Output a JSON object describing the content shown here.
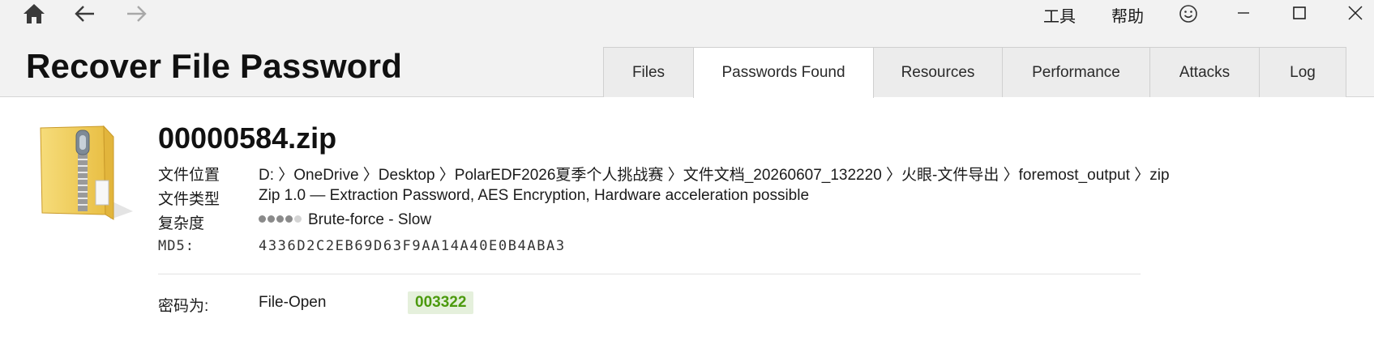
{
  "toolbar": {
    "icons": [
      "home-icon",
      "back-arrow-icon",
      "forward-arrow-icon"
    ]
  },
  "menu": {
    "tools": "工具",
    "help": "帮助",
    "feedback_icon": "smiley-icon"
  },
  "window_controls": [
    "minimize-icon",
    "maximize-icon",
    "close-icon"
  ],
  "app": {
    "title": "Recover File Password"
  },
  "tabs": [
    {
      "label": "Files",
      "active": false
    },
    {
      "label": "Passwords Found",
      "active": true
    },
    {
      "label": "Resources",
      "active": false
    },
    {
      "label": "Performance",
      "active": false
    },
    {
      "label": "Attacks",
      "active": false
    },
    {
      "label": "Log",
      "active": false
    }
  ],
  "file": {
    "icon": "zip-folder-icon",
    "name": "00000584.zip",
    "location_label": "文件位置",
    "location_value": "D: 〉OneDrive 〉Desktop 〉PolarEDF2026夏季个人挑战赛 〉文件文档_20260607_132220 〉火眼-文件导出 〉foremost_output 〉zip",
    "type_label": "文件类型",
    "type_value": "Zip 1.0 — Extraction Password, AES Encryption, Hardware acceleration possible",
    "complexity_label": "复杂度",
    "complexity_level": 4,
    "complexity_max": 5,
    "complexity_value": "Brute-force - Slow",
    "md5_label": "MD5:",
    "md5_value": "4336D2C2EB69D63F9AA14A40E0B4ABA3"
  },
  "result": {
    "label": "密码为:",
    "kind": "File-Open",
    "password": "003322",
    "password_color": "#4c9a0e"
  }
}
